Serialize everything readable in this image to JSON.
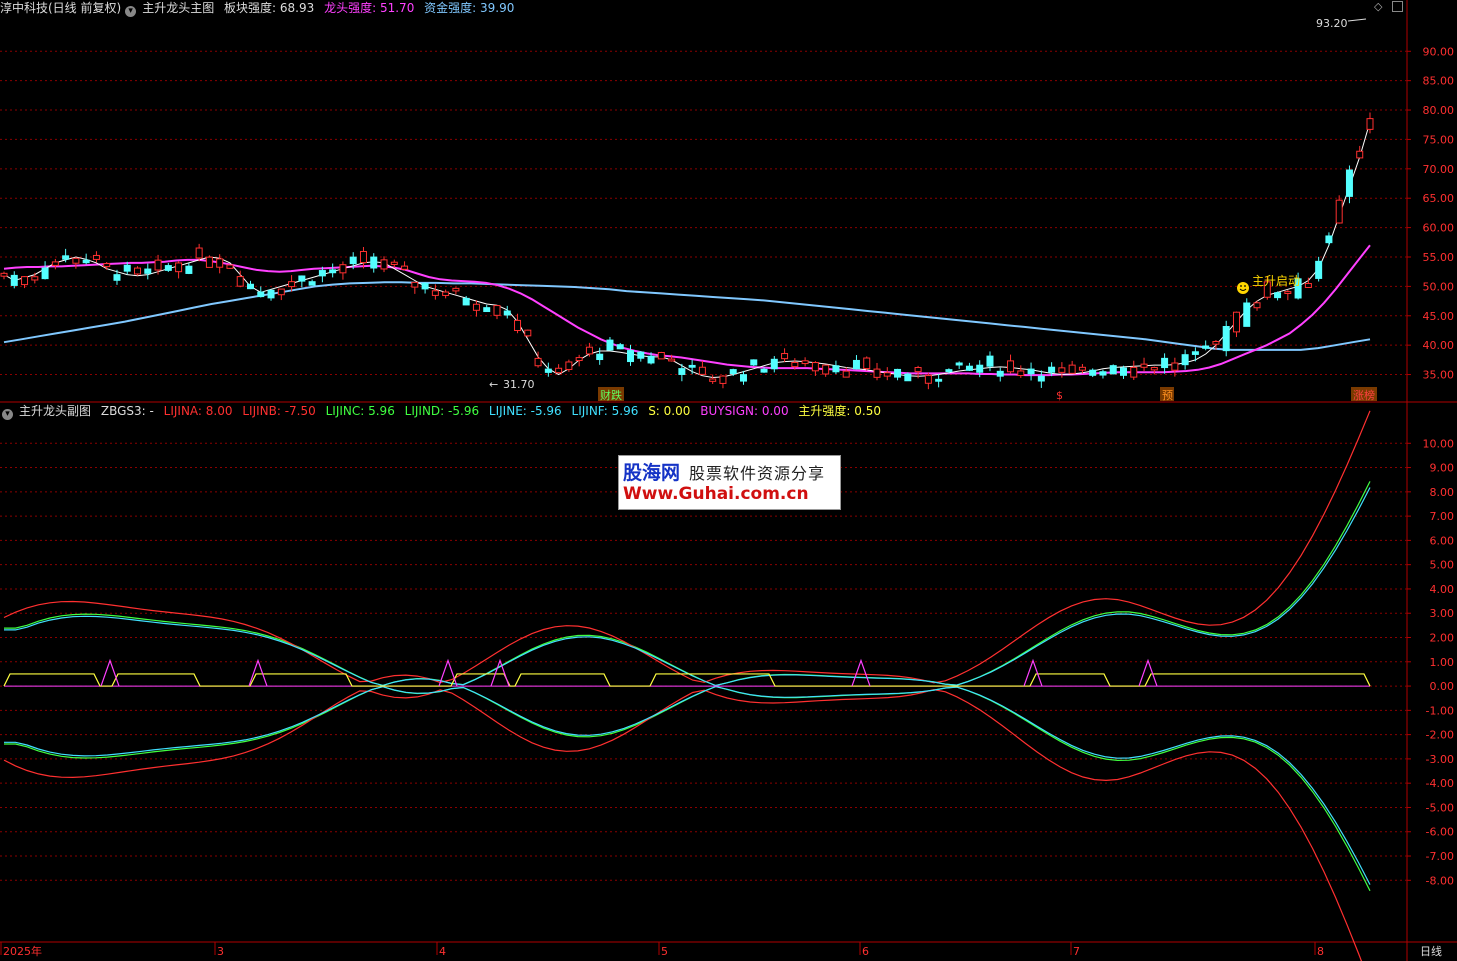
{
  "main_header": {
    "stock": "淳中科技(日线 前复权)",
    "indicator_name": "主升龙头主图",
    "items": [
      {
        "label": "板块强度:",
        "value": "68.93",
        "color": "#dcdcdc"
      },
      {
        "label": "龙头强度:",
        "value": "51.70",
        "color": "#ff40ff"
      },
      {
        "label": "资金强度:",
        "value": "39.90",
        "color": "#80c8ff"
      }
    ]
  },
  "sub_header": {
    "indicator_name": "主升龙头副图",
    "items": [
      {
        "text": "ZBGS3: -",
        "color": "#dcdcdc"
      },
      {
        "text": "LIJINA: 8.00",
        "color": "#ff3030"
      },
      {
        "text": "LIJINB: -7.50",
        "color": "#ff3030"
      },
      {
        "text": "LIJINC: 5.96",
        "color": "#40ff40"
      },
      {
        "text": "LIJIND: -5.96",
        "color": "#40ff40"
      },
      {
        "text": "LIJINE: -5.96",
        "color": "#40e0ff"
      },
      {
        "text": "LIJINF: 5.96",
        "color": "#40e0ff"
      },
      {
        "text": "S: 0.00",
        "color": "#ffff40"
      },
      {
        "text": "BUYSIGN: 0.00",
        "color": "#ff40ff"
      },
      {
        "text": "主升强度: 0.50",
        "color": "#ffff40"
      }
    ]
  },
  "main_axis": {
    "ticks": [
      "90.00",
      "85.00",
      "80.00",
      "75.00",
      "70.00",
      "65.00",
      "60.00",
      "55.00",
      "50.00",
      "45.00",
      "40.00",
      "35.00"
    ],
    "values": [
      90,
      85,
      80,
      75,
      70,
      65,
      60,
      55,
      50,
      45,
      40,
      35
    ],
    "ylim": [
      30.5,
      96
    ]
  },
  "sub_axis": {
    "ticks": [
      "10.00",
      "9.00",
      "8.00",
      "7.00",
      "6.00",
      "5.00",
      "4.00",
      "3.00",
      "2.00",
      "1.00",
      "0.00",
      "-1.00",
      "-2.00",
      "-3.00",
      "-4.00",
      "-5.00",
      "-6.00",
      "-7.00",
      "-8.00"
    ],
    "values": [
      10,
      9,
      8,
      7,
      6,
      5,
      4,
      3,
      2,
      1,
      0,
      -1,
      -2,
      -3,
      -4,
      -5,
      -6,
      -7,
      -8
    ],
    "ylim": [
      -10.5,
      11
    ]
  },
  "time_axis": {
    "labels": [
      "2025年",
      "3",
      "4",
      "5",
      "6",
      "7",
      "8"
    ],
    "period": "日线"
  },
  "annotations": {
    "high": "93.20",
    "low": "31.70",
    "signal": "主升启动",
    "markers": [
      {
        "text": "财跌",
        "color": "#60ff60"
      },
      {
        "text": "$",
        "color": "#ff3030"
      },
      {
        "text": "预",
        "color": "#ff9020"
      },
      {
        "text": "涨榜",
        "color": "#ff4040"
      }
    ]
  },
  "watermark": {
    "line1": "股海网",
    "line1b": "股票软件资源分享",
    "line2": "Www.Guhai.com.cn"
  },
  "colors": {
    "up": "#ff3030",
    "down": "#54ffff",
    "ma_short": "#ffffff",
    "ma_mid": "#ff40ff",
    "ma_long": "#80c8ff",
    "grid": "#8b0000"
  },
  "chart_data": {
    "type": "candlestick",
    "series": [
      {
        "name": "ma_short",
        "values": [
          52,
          51,
          51.5,
          52,
          53,
          54,
          54.5,
          55,
          54.6,
          54,
          53,
          52.5,
          52,
          51.8,
          52,
          52.5,
          53,
          53.5,
          54,
          54.5,
          55,
          54.8,
          54,
          52,
          50,
          49,
          49.5,
          50,
          50.5,
          51,
          51.5,
          52,
          52.5,
          53,
          53.5,
          54,
          54.2,
          54,
          53,
          52,
          51,
          50,
          49.5,
          49,
          48.5,
          48,
          47.5,
          47,
          46.8,
          46,
          44,
          41,
          38,
          36,
          35,
          36,
          37.5,
          38.5,
          39,
          39,
          38.8,
          38.5,
          38.2,
          38,
          38,
          37.5,
          36.5,
          35.5,
          34.8,
          34.5,
          34.6,
          35,
          35.5,
          36,
          36.5,
          37,
          37.2,
          37.3,
          37.2,
          37,
          36.8,
          36.5,
          36.2,
          36,
          35.8,
          35.5,
          35.3,
          35,
          34.8,
          34.7,
          34.8,
          35,
          35.3,
          35.6,
          35.8,
          36,
          36.2,
          36.3,
          36.2,
          36,
          35.8,
          35.5,
          35.2,
          35,
          35.1,
          35.3,
          35.6,
          36,
          36.2,
          36.3,
          36.4,
          36.5,
          36.6,
          36.6,
          36.7,
          37,
          37.5,
          38.5,
          40,
          42,
          44,
          46,
          47.5,
          48.5,
          49,
          49.5,
          50,
          51,
          53,
          57,
          62,
          67,
          72,
          78
        ]
      },
      {
        "name": "ma_mid",
        "values": [
          53,
          53.2,
          53.3,
          53.3,
          53.4,
          53.4,
          53.5,
          53.6,
          53.7,
          53.8,
          53.9,
          54,
          54,
          54.1,
          54.2,
          54.4,
          54.5,
          54.5,
          54.3,
          54,
          53.6,
          53.2,
          52.8,
          52.6,
          52.5,
          52.6,
          52.8,
          53,
          53.1,
          53.2,
          53.3,
          53.4,
          53.5,
          53.4,
          53.2,
          52.8,
          52.2,
          51.6,
          51.2,
          51,
          50.9,
          50.8,
          50.6,
          50.2,
          49.6,
          48.8,
          47.8,
          46.6,
          45.4,
          44.2,
          43,
          42,
          41,
          40.2,
          39.5,
          39,
          38.6,
          38.3,
          38.1,
          37.9,
          37.6,
          37.3,
          37,
          36.7,
          36.5,
          36.3,
          36.2,
          36.1,
          36.1,
          36.1,
          36.1,
          36,
          35.9,
          35.8,
          35.7,
          35.6,
          35.5,
          35.4,
          35.3,
          35.2,
          35.2,
          35.2,
          35.2,
          35.2,
          35.2,
          35.1,
          35.1,
          35,
          35,
          34.9,
          34.9,
          34.9,
          35,
          35,
          35.1,
          35.2,
          35.3,
          35.4,
          35.4,
          35.4,
          35.4,
          35.4,
          35.5,
          35.6,
          35.8,
          36.2,
          36.8,
          37.6,
          38.4,
          39.2,
          40,
          41,
          42,
          43.5,
          45.2,
          47.2,
          49.5,
          52,
          54.5,
          57
        ]
      },
      {
        "name": "ma_long",
        "values": [
          40.5,
          41,
          41.5,
          42,
          42.5,
          43,
          43.5,
          44,
          44.6,
          45.2,
          45.8,
          46.4,
          47,
          47.5,
          48,
          48.5,
          49,
          49.5,
          50,
          50.3,
          50.5,
          50.6,
          50.7,
          50.7,
          50.6,
          50.6,
          50.5,
          50.5,
          50.4,
          50.3,
          50.2,
          50.1,
          50,
          49.9,
          49.7,
          49.5,
          49.2,
          49,
          48.8,
          48.6,
          48.4,
          48.2,
          48,
          47.8,
          47.6,
          47.3,
          47,
          46.7,
          46.4,
          46.1,
          45.8,
          45.5,
          45.2,
          44.9,
          44.6,
          44.3,
          44,
          43.7,
          43.4,
          43.1,
          42.8,
          42.5,
          42.2,
          41.9,
          41.6,
          41.3,
          41,
          40.6,
          40.2,
          39.8,
          39.4,
          39.2,
          39.2,
          39.2,
          39.2,
          39.2,
          39.5,
          40,
          40.5,
          41
        ]
      }
    ],
    "sub_series": [
      {
        "name": "LIJINA",
        "color": "#ff3030"
      },
      {
        "name": "LIJINB",
        "color": "#ff3030"
      },
      {
        "name": "LIJINC",
        "color": "#40ff40"
      },
      {
        "name": "LIJIND",
        "color": "#40ff40"
      },
      {
        "name": "LIJINE",
        "color": "#40e0ff"
      },
      {
        "name": "LIJINF",
        "color": "#40e0ff"
      },
      {
        "name": "S",
        "color": "#ffff40"
      },
      {
        "name": "BUYSIGN",
        "color": "#ff40ff"
      }
    ]
  }
}
